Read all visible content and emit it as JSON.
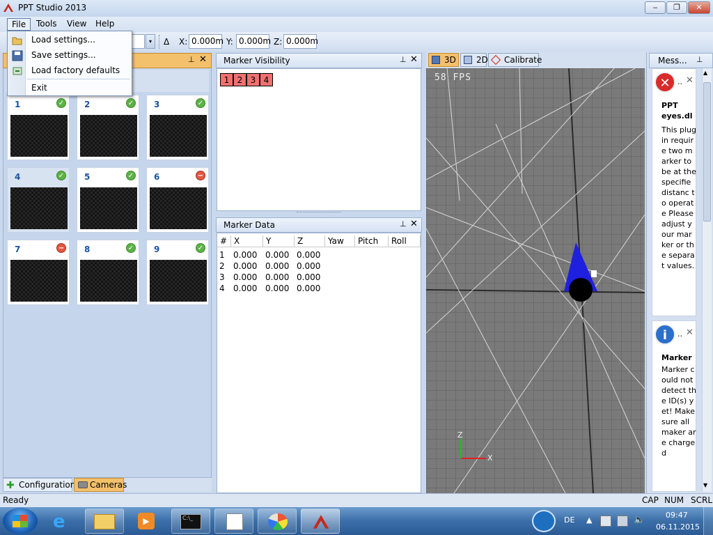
{
  "window": {
    "title": "PPT Studio 2013",
    "min_label": "‒",
    "max_label": "❐",
    "close_label": "✕"
  },
  "menu": {
    "items": [
      "File",
      "Tools",
      "View",
      "Help"
    ]
  },
  "file_menu": {
    "items": [
      "Load settings...",
      "Save settings...",
      "Load factory defaults",
      "Exit"
    ]
  },
  "toolbar": {
    "delta_symbol": "Δ",
    "x_label": "X:",
    "x_value": "0.000m",
    "y_label": "Y:",
    "y_value": "0.000m",
    "z_label": "Z:",
    "z_value": "0.000m"
  },
  "cameras": {
    "pin": "⊥",
    "close": "✕",
    "items": [
      {
        "label": "1",
        "status": "ok"
      },
      {
        "label": "2",
        "status": "ok"
      },
      {
        "label": "3",
        "status": "ok"
      },
      {
        "label": "4",
        "status": "ok"
      },
      {
        "label": "5",
        "status": "ok"
      },
      {
        "label": "6",
        "status": "error"
      },
      {
        "label": "7",
        "status": "error"
      },
      {
        "label": "8",
        "status": "ok"
      },
      {
        "label": "9",
        "status": "ok"
      }
    ]
  },
  "bottom_tabs": {
    "configuration": "Configuration",
    "cameras": "Cameras"
  },
  "marker_visibility": {
    "title": "Marker Visibility",
    "markers": [
      "1",
      "2",
      "3",
      "4"
    ]
  },
  "marker_data": {
    "title": "Marker Data",
    "columns": [
      "#",
      "X",
      "Y",
      "Z",
      "Yaw",
      "Pitch",
      "Roll"
    ],
    "rows": [
      [
        "1",
        "0.000",
        "0.000",
        "0.000"
      ],
      [
        "2",
        "0.000",
        "0.000",
        "0.000"
      ],
      [
        "3",
        "0.000",
        "0.000",
        "0.000"
      ],
      [
        "4",
        "0.000",
        "0.000",
        "0.000"
      ]
    ]
  },
  "view": {
    "tabs": [
      "3D",
      "2D",
      "Calibrate"
    ],
    "fps": "58 FPS",
    "axis_x": "X",
    "axis_z": "Z"
  },
  "messages": {
    "title": "Mess...",
    "items": [
      {
        "type": "error",
        "ellipsis": "..",
        "heading": "PPT eyes.dl",
        "text": "This plugin require two marker to be at the specifie distanc to operate Please adjust your marker or the separat values."
      },
      {
        "type": "info",
        "ellipsis": "..",
        "heading": "Marker",
        "text": "Marker could not detect the ID(s) yet! Make sure all maker are charged"
      }
    ]
  },
  "statusbar": {
    "text": "Ready",
    "cap": "CAP",
    "num": "NUM",
    "scrl": "SCRL"
  },
  "taskbar": {
    "lang": "DE",
    "time": "09:47",
    "date": "06.11.2015",
    "apps": [
      "internet-explorer",
      "file-explorer",
      "media-player",
      "command-prompt",
      "paint-brush",
      "paint-palette",
      "ppt-studio"
    ]
  },
  "colors": {
    "accent": "#f3c06c",
    "marker_off": "#f07070",
    "ok": "#5cb246",
    "error": "#e05842",
    "cone": "#1f1fe0"
  }
}
